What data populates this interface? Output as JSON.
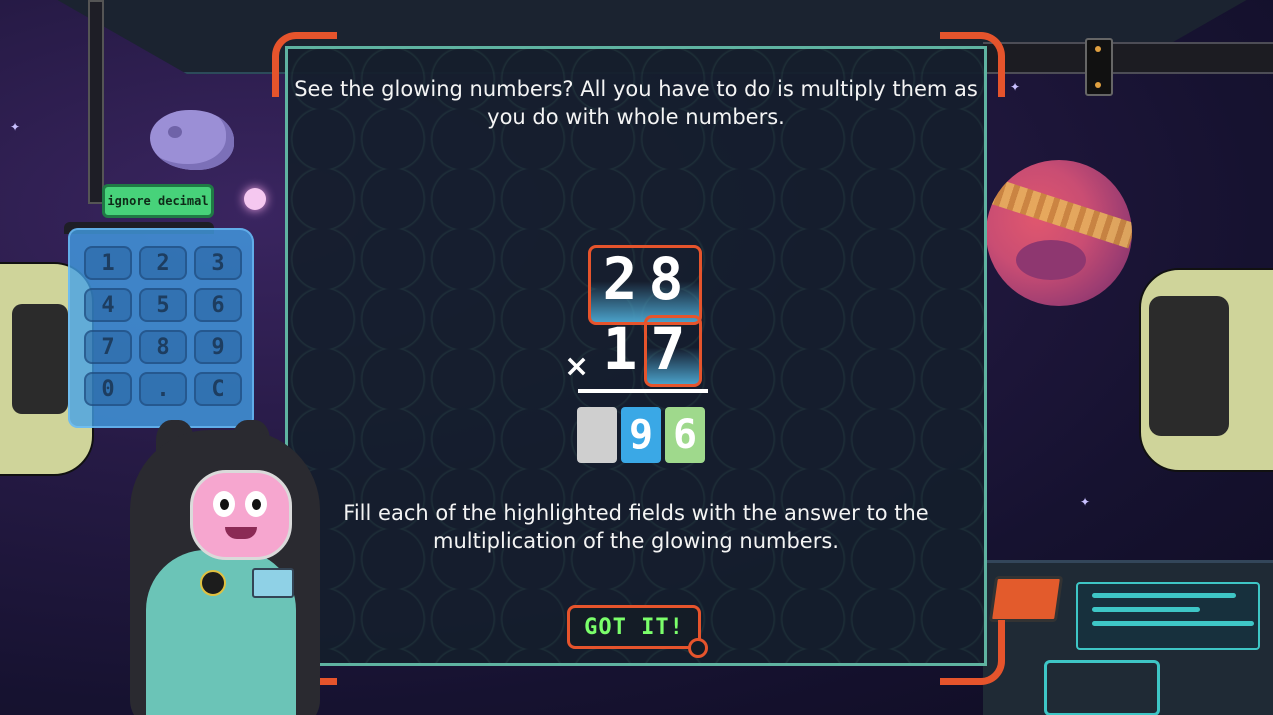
{
  "intro_text": "See the glowing numbers? All you have to do is multiply them as you do with whole numbers.",
  "instruction_text": "Fill each of the highlighted fields with the answer to the multiplication of the glowing numbers.",
  "got_it_label": "GOT IT!",
  "keypad": {
    "mode_label": "ignore decimal",
    "keys": [
      "1",
      "2",
      "3",
      "4",
      "5",
      "6",
      "7",
      "8",
      "9",
      "0",
      ".",
      "C"
    ]
  },
  "problem": {
    "multiplicand": [
      "2",
      "8"
    ],
    "operator": "×",
    "multiplier": [
      "1",
      "7"
    ],
    "answer_digits": [
      "",
      "9",
      "6"
    ]
  },
  "colors": {
    "accent_orange": "#e6542c",
    "frame_teal": "#5fb3a1",
    "button_text_green": "#7bff6b",
    "answer_blue": "#3aa8e6",
    "answer_green": "#9fd98c",
    "answer_empty_gray": "#cfcfcf"
  }
}
